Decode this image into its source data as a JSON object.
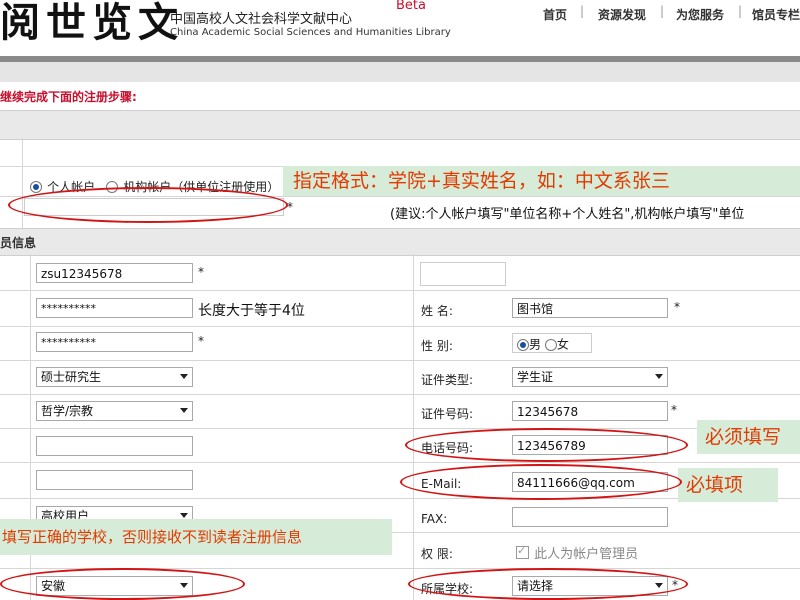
{
  "header": {
    "logo_text": "阅世览文",
    "org_name_cn": "中国高校人文社会科学文献中心",
    "org_name_en": "China Academic Social Sciences and Humanities Library",
    "beta": "Beta",
    "nav": [
      "首页",
      "资源发现",
      "为您服务",
      "馆员专栏"
    ]
  },
  "instruction": "继续完成下面的注册步骤:",
  "account": {
    "type_options": [
      "个人帐户",
      "机构帐户（供单位注册使用）"
    ],
    "selected_type": "个人帐户",
    "name_star": "*",
    "suggestion": "(建议:个人帐户填写\"单位名称+个人姓名\",机构帐户填写\"单位"
  },
  "section": {
    "basic_info": "员信息"
  },
  "left_fields": {
    "username": "zsu12345678",
    "password": "**********",
    "password_hint": "长度大于等于4位",
    "confirm_password": "**********",
    "education": "硕士研究生",
    "discipline": "哲学/宗教",
    "user_type": "高校用户",
    "province": "安徽",
    "star": "*"
  },
  "right_fields": {
    "name_label": "姓  名:",
    "name_value": "图书馆",
    "gender_label": "性  别:",
    "gender_options": [
      "男",
      "女"
    ],
    "gender_selected": "男",
    "id_type_label": "证件类型:",
    "id_type_value": "学生证",
    "id_number_label": "证件号码:",
    "id_number_value": "12345678",
    "phone_label": "电话号码:",
    "phone_value": "123456789",
    "email_label": "E-Mail:",
    "email_value": "84111666@qq.com",
    "fax_label": "FAX:",
    "fax_value": "",
    "permission_label": "权  限:",
    "permission_option": "此人为帐户管理员",
    "school_label": "所属学校:",
    "school_value": "请选择",
    "star": "*"
  },
  "callouts": {
    "format": "指定格式：学院+真实姓名，如：中文系张三",
    "required_fill": "必须填写",
    "required_item": "必填项",
    "school_tip": "填写正确的学校，否则接收不到读者注册信息"
  },
  "colors": {
    "annotation_red": "#d21414",
    "callout_bg": "#d7ecd8",
    "callout_text": "#e23a00",
    "instruction_red": "#c8102e"
  }
}
